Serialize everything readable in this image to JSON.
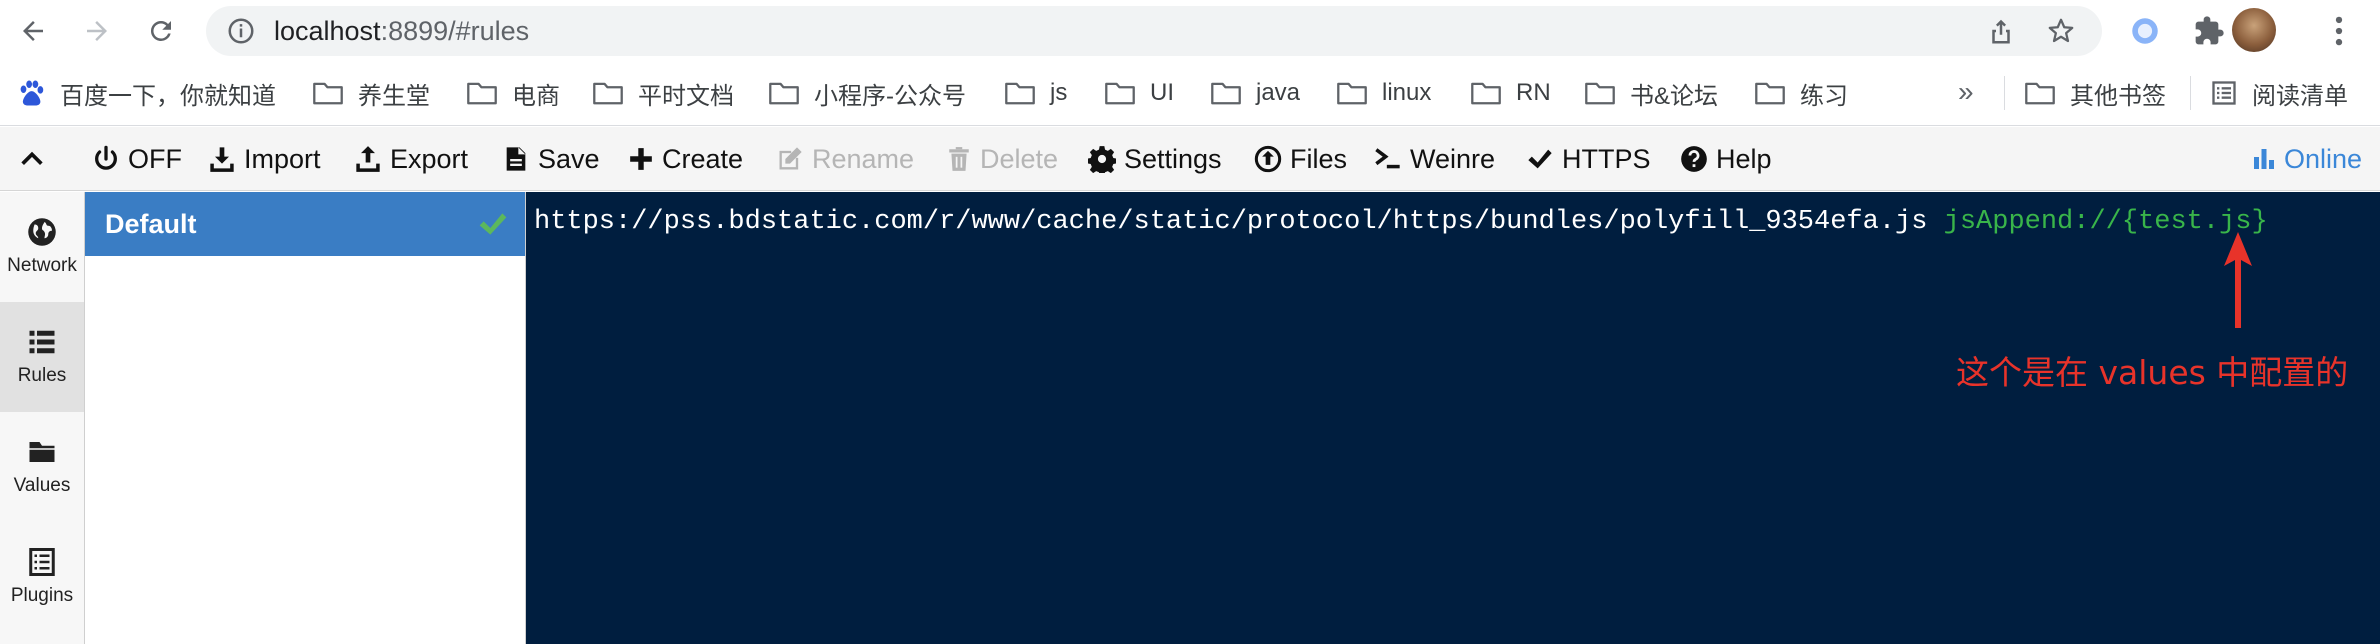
{
  "browser": {
    "url_host": "localhost",
    "url_rest": ":8899/#rules"
  },
  "bookmarks": {
    "items": [
      "百度一下，你就知道",
      "养生堂",
      "电商",
      "平时文档",
      "小程序-公众号",
      "js",
      "UI",
      "java",
      "linux",
      "RN",
      "书&论坛",
      "练习"
    ],
    "overflow": "»",
    "other": "其他书签",
    "reading_list": "阅读清单"
  },
  "menu": {
    "off": "OFF",
    "import": "Import",
    "export": "Export",
    "save": "Save",
    "create": "Create",
    "rename": "Rename",
    "delete": "Delete",
    "settings": "Settings",
    "files": "Files",
    "weinre": "Weinre",
    "https": "HTTPS",
    "help": "Help",
    "online": "Online"
  },
  "sidebar": {
    "items": [
      {
        "label": "Network",
        "icon": "globe-icon"
      },
      {
        "label": "Rules",
        "icon": "list-icon",
        "active": true
      },
      {
        "label": "Values",
        "icon": "folder-icon"
      },
      {
        "label": "Plugins",
        "icon": "plugin-list-icon"
      }
    ]
  },
  "rules": {
    "items": [
      {
        "name": "Default",
        "selected": true
      }
    ]
  },
  "editor": {
    "url": "https://pss.bdstatic.com/r/www/cache/static/protocol/https/bundles/polyfill_9354efa.js",
    "operation": "jsAppend://{test.js}"
  },
  "annotation": {
    "text": "这个是在 values 中配置的"
  },
  "colors": {
    "editor_bg": "#001e3f",
    "rule_selected": "#3a7dc4",
    "operation_green": "#39b54a",
    "annotation_red": "#e8332a",
    "online_blue": "#3b87d8"
  }
}
